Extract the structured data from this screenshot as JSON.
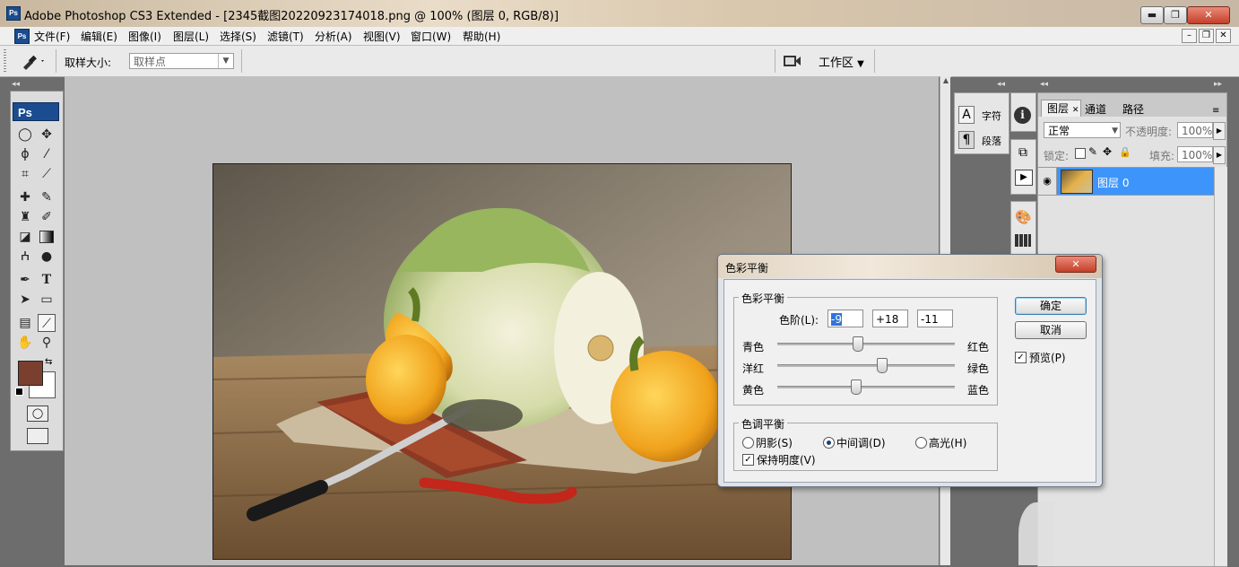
{
  "window": {
    "title": "Adobe Photoshop CS3 Extended - [2345截图20220923174018.png @ 100% (图层 0, RGB/8)]",
    "app_logo": "Ps",
    "minimize": "▬",
    "maximize": "❐",
    "close": "✕"
  },
  "menu": {
    "logo": "Ps",
    "items": [
      "文件(F)",
      "编辑(E)",
      "图像(I)",
      "图层(L)",
      "选择(S)",
      "滤镜(T)",
      "分析(A)",
      "视图(V)",
      "窗口(W)",
      "帮助(H)"
    ],
    "doc_minimize": "–",
    "doc_restore": "❐",
    "doc_close": "✕"
  },
  "options": {
    "tool_icon": "eyedropper-icon",
    "sample_size_label": "取样大小:",
    "sample_size_value": "取样点",
    "workspace_label": "工作区"
  },
  "toolbox": {
    "logo": "Ps",
    "tools": [
      "ellipse-marquee-icon",
      "move-icon",
      "lasso-icon",
      "magic-wand-icon",
      "crop-icon",
      "slice-icon",
      "healing-brush-icon",
      "brush-icon",
      "clone-stamp-icon",
      "history-brush-icon",
      "eraser-icon",
      "gradient-icon",
      "dodge-icon",
      "blur-icon",
      "pen-icon",
      "type-icon",
      "path-selection-icon",
      "rectangle-shape-icon",
      "notes-icon",
      "eyedropper-icon",
      "hand-icon",
      "zoom-icon"
    ],
    "type_tool_glyph": "T",
    "foreground_color": "#7a3f2f",
    "background_color": "#ffffff"
  },
  "char_panel": {
    "character": "字符",
    "paragraph": "段落",
    "character_icon_glyph": "A",
    "paragraph_icon_glyph": "¶"
  },
  "layers_panel": {
    "tabs": [
      "图层",
      "通道",
      "路径"
    ],
    "tab_close_glyph": "✕",
    "blend_mode": "正常",
    "opacity_label": "不透明度:",
    "opacity_value": "100%",
    "lock_label": "锁定:",
    "fill_label": "填充:",
    "fill_value": "100%",
    "layers": [
      {
        "name": "图层 0"
      }
    ]
  },
  "dialog": {
    "title": "色彩平衡",
    "group_color_balance": "色彩平衡",
    "levels_label": "色阶(L):",
    "levels": [
      "-9",
      "+18",
      "-11"
    ],
    "sliders": [
      {
        "left": "青色",
        "right": "红色",
        "value": -9
      },
      {
        "left": "洋红",
        "right": "绿色",
        "value": 18
      },
      {
        "left": "黄色",
        "right": "蓝色",
        "value": -11
      }
    ],
    "group_tone_balance": "色调平衡",
    "tones": [
      "阴影(S)",
      "中间调(D)",
      "高光(H)"
    ],
    "tone_selected_index": 1,
    "preserve_luminosity": "保持明度(V)",
    "ok": "确定",
    "cancel": "取消",
    "preview": "预览(P)",
    "close": "✕"
  }
}
